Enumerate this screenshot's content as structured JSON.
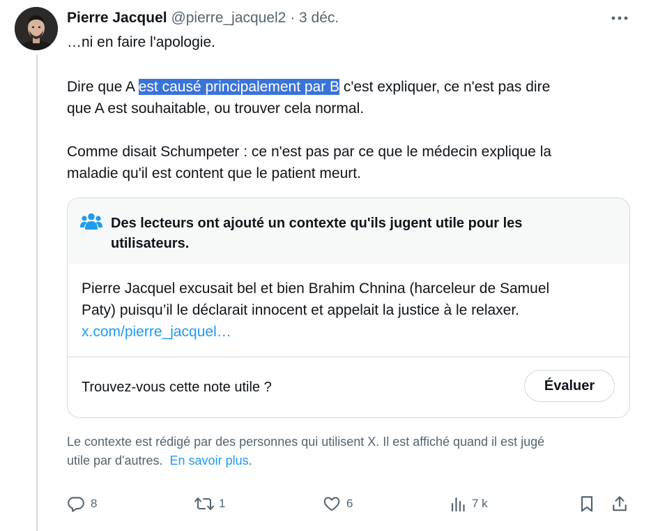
{
  "tweet": {
    "author_name": "Pierre Jacquel",
    "handle": "@pierre_jacquel2",
    "separator": "·",
    "date": "3 déc.",
    "lines": {
      "l1": "…ni en faire l'apologie.",
      "l2_before": "Dire que A ",
      "l2_highlight": "est causé principalement par B",
      "l2_after": " c'est expliquer, ce n'est pas dire",
      "l3": "que A est souhaitable, ou trouver cela normal.",
      "l4": "Comme disait Schumpeter : ce n'est pas par ce que le médecin explique la",
      "l5": "maladie qu'il est content que le patient meurt."
    }
  },
  "note": {
    "title_line1": "Des lecteurs ont ajouté un contexte qu'ils jugent utile pour les",
    "title_line2": "utilisateurs.",
    "body_line1": "Pierre Jacquel excusait bel et bien Brahim Chnina (harceleur de Samuel",
    "body_line2": "Paty) puisqu’il le déclarait innocent et appelait la justice à le relaxer.",
    "link_text": "x.com/pierre_jacquel…",
    "question": "Trouvez-vous cette note utile ?",
    "rate_label": "Évaluer",
    "accent_color": "#1d9bf0"
  },
  "disclaimer": {
    "line1": "Le contexte est rédigé par des personnes qui utilisent X. Il est affiché quand il est jugé",
    "line2": "utile par d'autres.",
    "learn_more": "En savoir plus",
    "period": "."
  },
  "actions": {
    "replies": "8",
    "reposts": "1",
    "likes": "6",
    "views": "7 k",
    "icons": [
      "reply-icon",
      "repost-icon",
      "like-icon",
      "views-icon",
      "bookmark-icon",
      "share-icon"
    ]
  }
}
